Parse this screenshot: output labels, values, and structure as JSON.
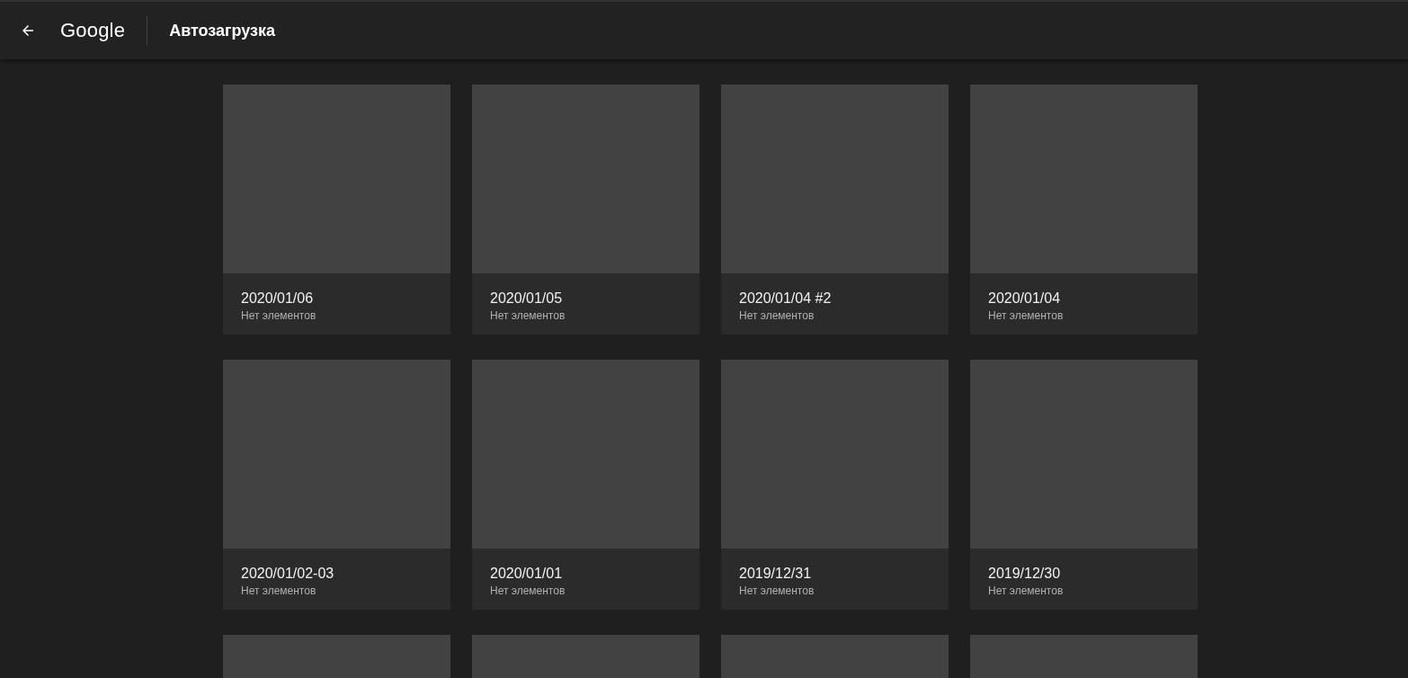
{
  "header": {
    "logo": "Google",
    "title": "Автозагрузка"
  },
  "albums": [
    {
      "kind": "album",
      "title": "2020/01/06",
      "subtitle": "Нет элементов"
    },
    {
      "kind": "album",
      "title": "2020/01/05",
      "subtitle": "Нет элементов"
    },
    {
      "kind": "album",
      "title": "2020/01/04 #2",
      "subtitle": "Нет элементов"
    },
    {
      "kind": "album",
      "title": "2020/01/04",
      "subtitle": "Нет элементов"
    },
    {
      "kind": "album",
      "title": "2020/01/02-03",
      "subtitle": "Нет элементов"
    },
    {
      "kind": "album",
      "title": "2020/01/01",
      "subtitle": "Нет элементов"
    },
    {
      "kind": "album",
      "title": "2019/12/31",
      "subtitle": "Нет элементов"
    },
    {
      "kind": "album",
      "title": "2019/12/30",
      "subtitle": "Нет элементов"
    },
    {
      "kind": "cut-off"
    },
    {
      "kind": "cut-off"
    },
    {
      "kind": "cut-off"
    },
    {
      "kind": "cut-off"
    }
  ]
}
